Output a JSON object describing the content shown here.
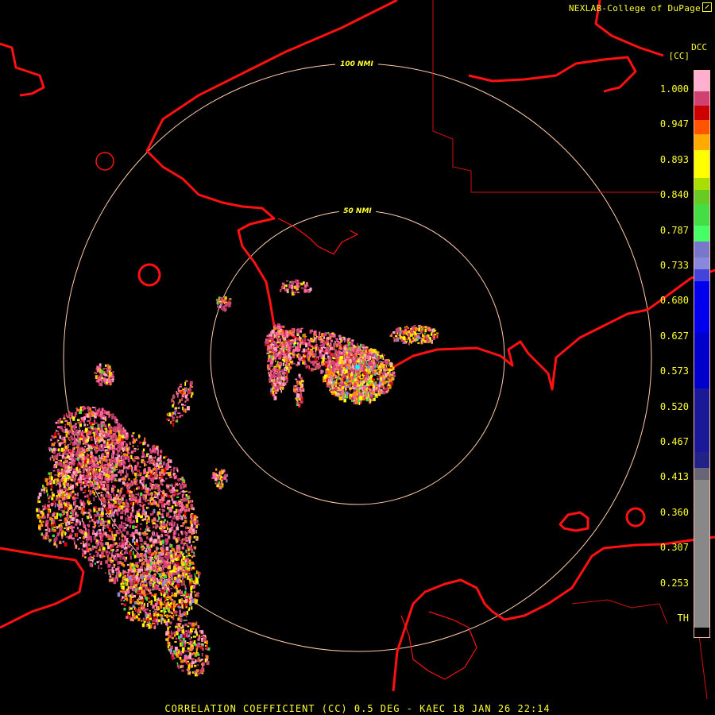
{
  "header": {
    "source": "NEXLAB-College of DuPage",
    "external_link_icon": "external-link-icon"
  },
  "product": {
    "code": "DCC",
    "unit": "[CC]"
  },
  "rings": [
    {
      "label": "100 NMI",
      "range_nmi": 100
    },
    {
      "label": "50 NMI",
      "range_nmi": 50
    }
  ],
  "color_scale": {
    "labels": [
      "1.000",
      "0.947",
      "0.893",
      "0.840",
      "0.787",
      "0.733",
      "0.680",
      "0.627",
      "0.573",
      "0.520",
      "0.467",
      "0.413",
      "0.360",
      "0.307",
      "0.253",
      "TH"
    ],
    "colors": {
      "pink": "#ffa8c8",
      "rose": "#d04070",
      "red": "#dd0000",
      "orange": "#ff8800",
      "yellow": "#ffff00",
      "green": "#44dd44",
      "lavender": "#8888dd",
      "blue": "#0000dd",
      "navy": "#222288",
      "gray": "#888888"
    }
  },
  "colors": {
    "background": "#000000",
    "borders": "#ff0000",
    "range_rings": "#ffccaa",
    "text": "#ffff33"
  },
  "footer": {
    "caption": "CORRELATION COEFFICIENT (CC) 0.5 DEG - KAEC 18 JAN 26 22:14"
  }
}
